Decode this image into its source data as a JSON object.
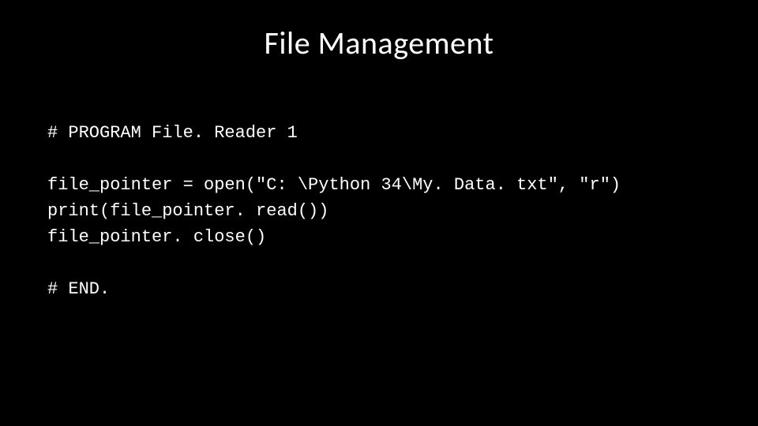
{
  "slide": {
    "title": "File Management",
    "code": {
      "line1": "# PROGRAM File. Reader 1",
      "blank1": "",
      "line2": "file_pointer = open(\"C: \\Python 34\\My. Data. txt\", \"r\")",
      "line3": "print(file_pointer. read())",
      "line4": "file_pointer. close()",
      "blank2": "",
      "line5": "# END."
    }
  }
}
